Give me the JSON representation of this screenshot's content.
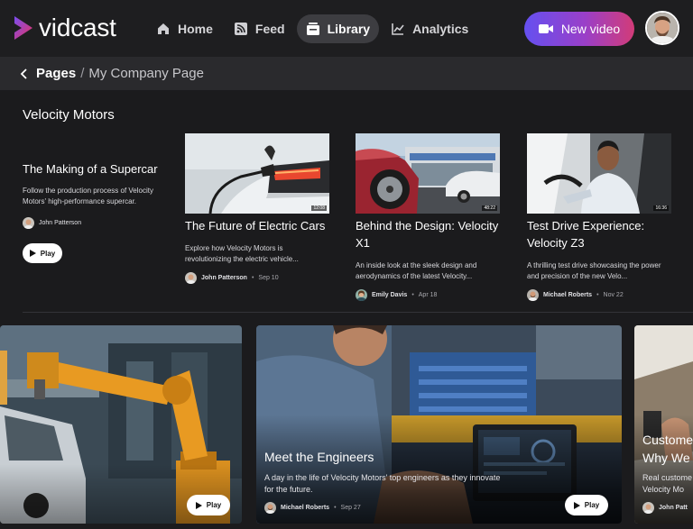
{
  "app": {
    "name": "vidcast"
  },
  "nav": {
    "items": [
      {
        "label": "Home",
        "icon": "home-icon"
      },
      {
        "label": "Feed",
        "icon": "rss-icon"
      },
      {
        "label": "Library",
        "icon": "library-icon",
        "active": true
      },
      {
        "label": "Analytics",
        "icon": "chart-icon"
      }
    ],
    "new_video_label": "New video"
  },
  "breadcrumb": {
    "root": "Pages",
    "separator": "/",
    "current": "My Company Page"
  },
  "section": {
    "title": "Velocity Motors",
    "feature": {
      "title": "The Making of a Supercar",
      "description": "Follow the production process of Velocity Motors' high-performance supercar.",
      "author": "John Patterson",
      "play_label": "Play"
    },
    "cards": [
      {
        "title": "The Future of Electric Cars",
        "duration": "12:08",
        "description": "Explore how Velocity Motors is revolutionizing the electric vehicle...",
        "author": "John Patterson",
        "date": "Sep 10"
      },
      {
        "title": "Behind the Design: Velocity X1",
        "duration": "48:22",
        "description": "An inside look at the sleek design and aerodynamics of the latest Velocity...",
        "author": "Emily Davis",
        "date": "Apr 18"
      },
      {
        "title": "Test Drive Experience: Velocity Z3",
        "duration": "16:36",
        "description": "A thrilling test drive showcasing the power and precision of the new Velo...",
        "author": "Michael Roberts",
        "date": "Nov 22"
      }
    ]
  },
  "tiles": [
    {
      "play_label": "Play"
    },
    {
      "title": "Meet the Engineers",
      "description": "A day in the life of Velocity Motors' top engineers as they innovate for the future.",
      "author": "Michael Roberts",
      "date": "Sep 27",
      "play_label": "Play"
    },
    {
      "title": "Custome Why We",
      "title_line1": "Custome",
      "title_line2": "Why We",
      "description_line1": "Real custome",
      "description_line2": "Velocity Mo",
      "author": "John Patt"
    }
  ],
  "colors": {
    "accent_start": "#6550f0",
    "accent_end": "#d23c78",
    "background": "#1b1b1d",
    "nav_active": "#3d3d41"
  }
}
